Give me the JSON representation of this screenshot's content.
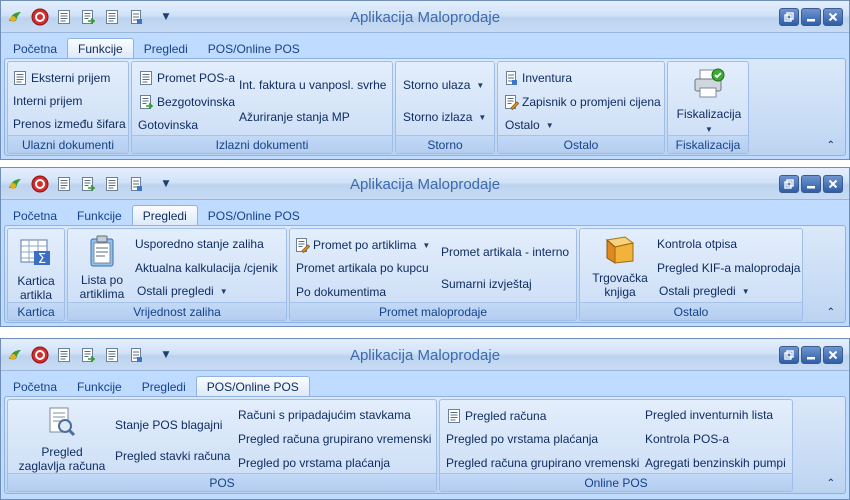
{
  "app_title": "Aplikacija Maloprodaje",
  "tabs": [
    "Početna",
    "Funkcije",
    "Pregledi",
    "POS/Online POS"
  ],
  "collapse_glyph": "⌃",
  "colors": {
    "title_text": "#3e6aaa",
    "ribbon_text": "#15428b",
    "window_border": "#6f8eb8",
    "ribbon_bg": "#c7dbf5"
  },
  "window1": {
    "active_tab": "Funkcije",
    "groups": {
      "ulazni": {
        "label": "Ulazni dokumenti",
        "eksterni": "Eksterni prijem",
        "interni": "Interni prijem",
        "prenos": "Prenos između šifara"
      },
      "izlazni": {
        "label": "Izlazni dokumenti",
        "promet_pos": "Promet POS-a",
        "bezgotovinska": "Bezgotovinska",
        "gotovinska": "Gotovinska",
        "int_faktura": "Int. faktura u vanposl. svrhe",
        "azuriranje": "Ažuriranje stanja MP"
      },
      "storno": {
        "label": "Storno",
        "ulaza": "Storno ulaza",
        "izlaza": "Storno izlaza"
      },
      "ostalo": {
        "label": "Ostalo",
        "inventura": "Inventura",
        "zapisnik": "Zapisnik o promjeni cijena",
        "ostalo": "Ostalo"
      },
      "fiskalizacija": {
        "label": "Fiskalizacija",
        "button": "Fiskalizacija"
      }
    }
  },
  "window2": {
    "active_tab": "Pregledi",
    "groups": {
      "kartica": {
        "label": "Kartica",
        "button_line1": "Kartica",
        "button_line2": "artikla"
      },
      "vrijednost": {
        "label": "Vrijednost zaliha",
        "lista_line1": "Lista po",
        "lista_line2": "artiklima",
        "usporedno": "Usporedno stanje zaliha",
        "aktualna": "Aktualna kalkulacija /cjenik",
        "ostali": "Ostali pregledi"
      },
      "promet": {
        "label": "Promet maloprodaje",
        "po_artiklima": "Promet po artiklima",
        "po_kupcu": "Promet artikala po kupcu",
        "po_dokumentima": "Po dokumentima",
        "interno": "Promet artikala - interno",
        "sumarni": "Sumarni izvještaj"
      },
      "ostalo": {
        "label": "Ostalo",
        "trgovacka_line1": "Trgovačka",
        "trgovacka_line2": "knjiga",
        "kontrola_otpisa": "Kontrola otpisa",
        "kif": "Pregled KIF-a maloprodaja",
        "ostali": "Ostali pregledi"
      }
    }
  },
  "window3": {
    "active_tab": "POS/Online POS",
    "groups": {
      "pos": {
        "label": "POS",
        "zaglavlja_line1": "Pregled",
        "zaglavlja_line2": "zaglavlja računa",
        "stanje": "Stanje POS blagajni",
        "stavki": "Pregled  stavki računa",
        "racuni_stavke": "Računi s pripadajućim stavkama",
        "grupirano": "Pregled računa grupirano vremenski",
        "vrste": "Pregled po vrstama plaćanja"
      },
      "online": {
        "label": "Online POS",
        "pregled_racuna": "Pregled računa",
        "vrste": "Pregled po vrstama plaćanja",
        "grupirano": "Pregled računa grupirano vremenski",
        "inventurnih": "Pregled inventurnih lista",
        "kontrola": "Kontrola POS-a",
        "agregati": "Agregati benzinskih pumpi"
      }
    }
  }
}
